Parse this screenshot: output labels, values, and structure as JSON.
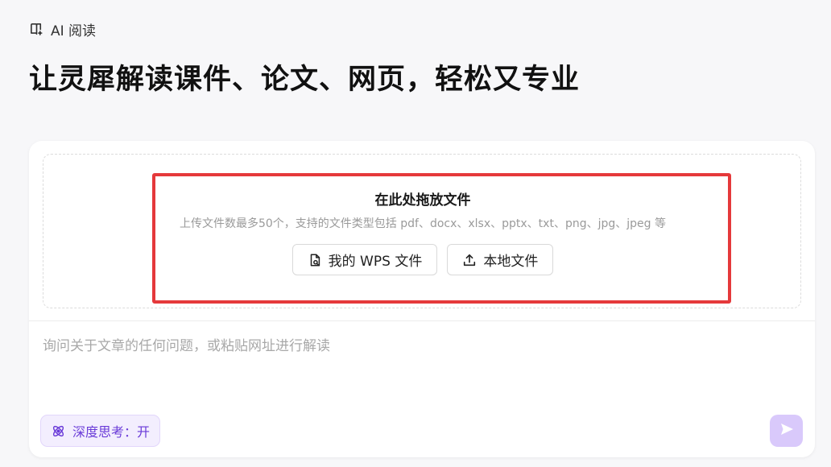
{
  "header": {
    "breadcrumb": "AI 阅读",
    "breadcrumb_icon": "book-sparkle-icon",
    "headline": "让灵犀解读课件、论文、网页，轻松又专业"
  },
  "upload": {
    "title": "在此处拖放文件",
    "description": "上传文件数最多50个，支持的文件类型包括 pdf、docx、xlsx、pptx、txt、png、jpg、jpeg 等",
    "wps_button": {
      "label": "我的 WPS 文件",
      "icon": "wps-file-icon"
    },
    "local_button": {
      "label": "本地文件",
      "icon": "upload-icon"
    },
    "highlight_color": "#e5393b"
  },
  "composer": {
    "placeholder": "询问关于文章的任何问题，或粘贴网址进行解读",
    "deep_think": {
      "label": "深度思考：开",
      "icon": "atom-icon",
      "color": "#6a3bd8"
    },
    "send_icon": "send-icon",
    "send_color": "#d9c9fb"
  }
}
